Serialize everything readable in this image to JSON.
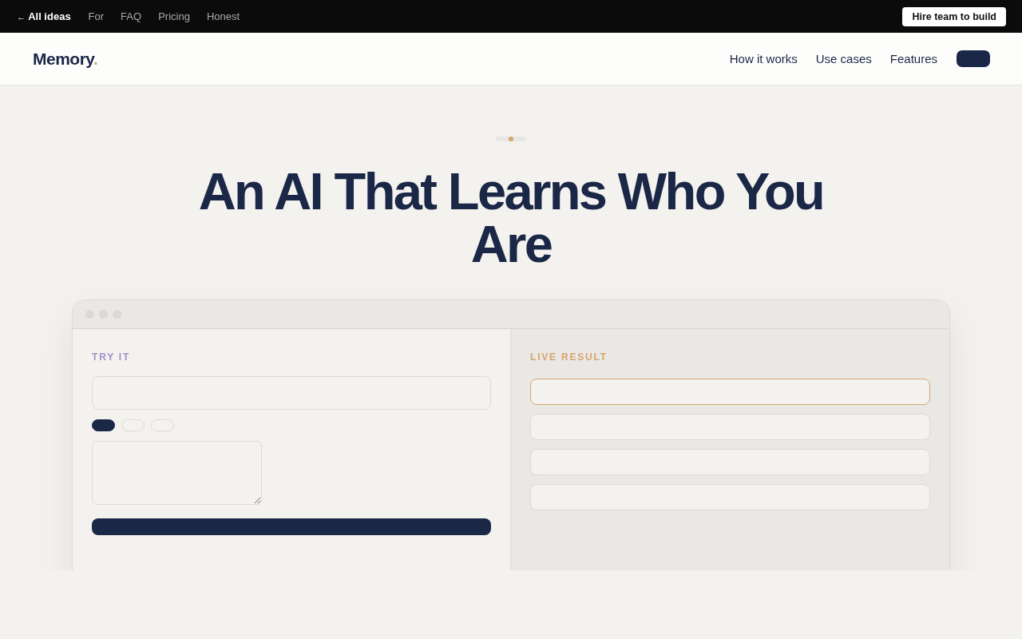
{
  "top_bar": {
    "back_link": {
      "arrow": "←",
      "label": "All ideas"
    },
    "links": [
      "For",
      "FAQ",
      "Pricing",
      "Honest"
    ],
    "cta": "Hire team to build"
  },
  "nav": {
    "logo": {
      "name": "Memory",
      "accent": "."
    },
    "links": [
      "How it works",
      "Use cases",
      "Features"
    ]
  },
  "hero": {
    "title": "An AI That Learns Who You Are"
  },
  "demo": {
    "input_panel": {
      "label": "TRY IT",
      "chips": [
        {
          "selected": true
        },
        {
          "selected": false
        },
        {
          "selected": false
        }
      ]
    },
    "result_panel": {
      "label": "LIVE RESULT",
      "rows": [
        {
          "selected": true
        },
        {
          "selected": false
        },
        {
          "selected": false
        },
        {
          "selected": false
        }
      ]
    }
  }
}
